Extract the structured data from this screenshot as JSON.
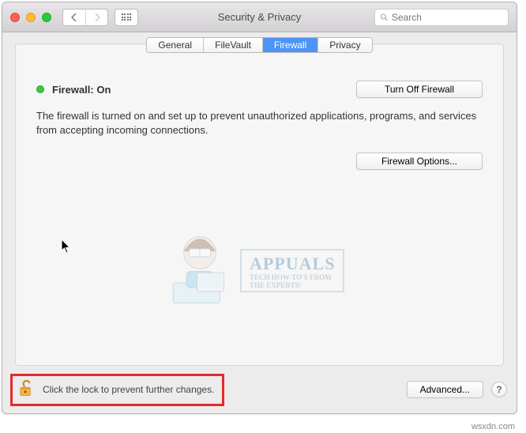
{
  "titlebar": {
    "title": "Security & Privacy",
    "search_placeholder": "Search"
  },
  "tabs": {
    "general": "General",
    "filevault": "FileVault",
    "firewall": "Firewall",
    "privacy": "Privacy"
  },
  "firewall": {
    "status_label": "Firewall: On",
    "turn_off_label": "Turn Off Firewall",
    "description": "The firewall is turned on and set up to prevent unauthorized applications, programs, and services from accepting incoming connections.",
    "options_label": "Firewall Options..."
  },
  "bottom": {
    "lock_text": "Click the lock to prevent further changes.",
    "advanced_label": "Advanced...",
    "help_label": "?"
  },
  "watermark": {
    "brand": "APPUALS",
    "tagline1": "TECH HOW-TO'S FROM",
    "tagline2": "THE EXPERTS!"
  },
  "sitemark": "wsxdn.com"
}
